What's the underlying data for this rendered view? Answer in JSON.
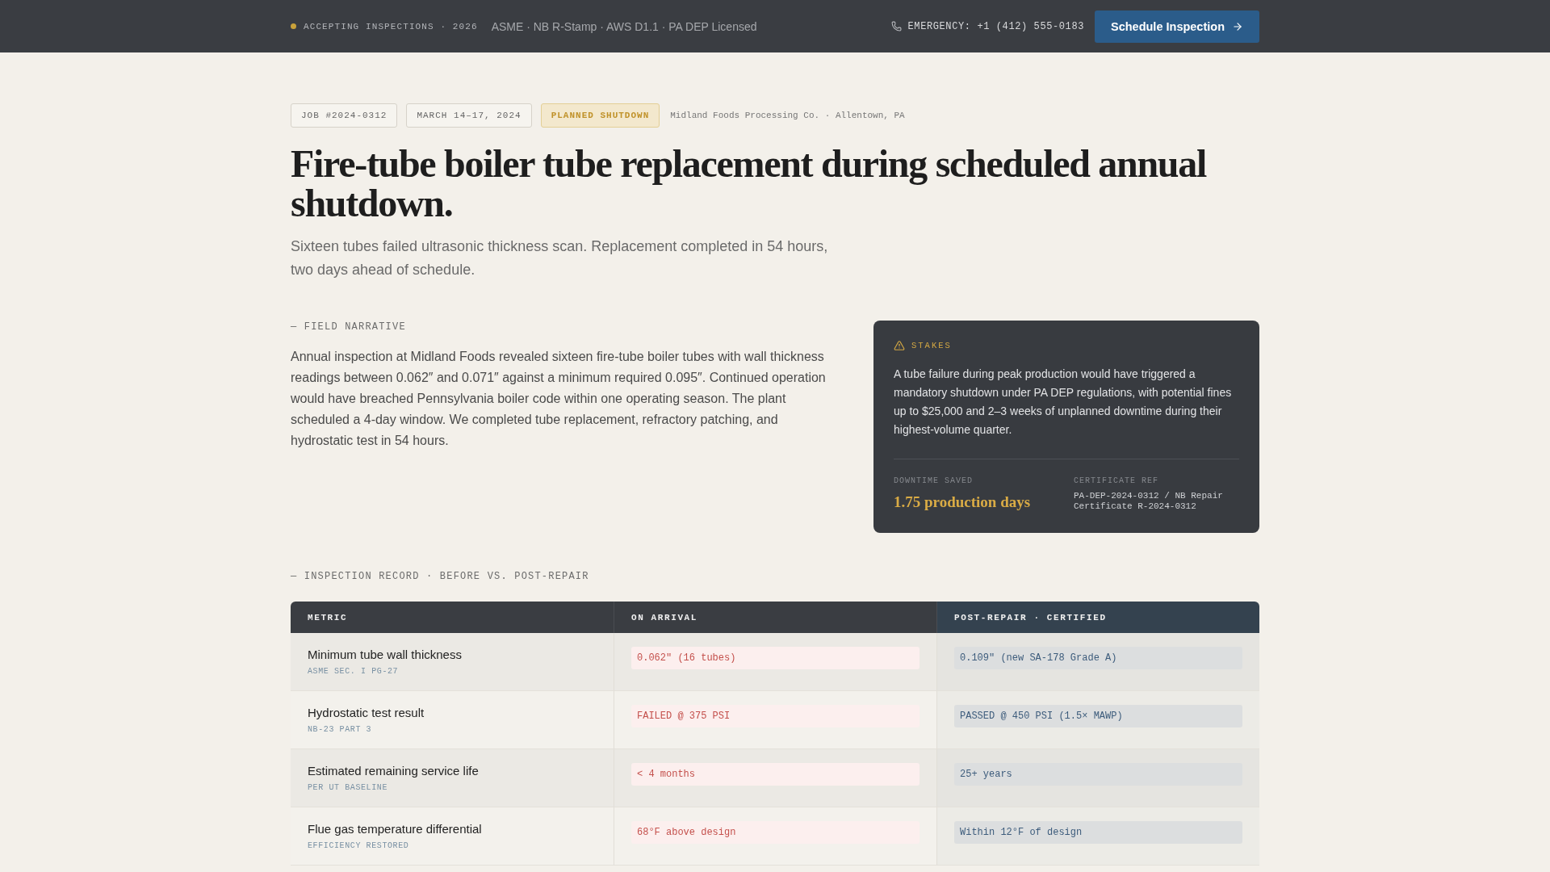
{
  "top_bar": {
    "status_label": "ACCEPTING INSPECTIONS · 2026",
    "credentials": "ASME · NB R-Stamp · AWS D1.1 · PA DEP Licensed",
    "emergency": "EMERGENCY: +1 (412) 555-0183",
    "cta_button": "Schedule Inspection"
  },
  "tags": [
    {
      "label": "JOB #2024-0312",
      "kind": "job"
    },
    {
      "label": "MARCH 14–17, 2024",
      "kind": "date"
    },
    {
      "label": "PLANNED SHUTDOWN",
      "kind": "status"
    }
  ],
  "client": "Midland Foods Processing Co. · Allentown, PA",
  "title": "Fire-tube boiler tube replacement during scheduled annual shutdown.",
  "subtitle": "Sixteen tubes failed ultrasonic thickness scan. Replacement completed in 54 hours, two days ahead of schedule.",
  "narrative": {
    "label": "— FIELD NARRATIVE",
    "body": "Annual inspection at Midland Foods revealed sixteen fire-tube boiler tubes with wall thickness readings between 0.062″ and 0.071″ against a minimum required 0.095″. Continued operation would have breached Pennsylvania boiler code within one operating season. The plant scheduled a 4-day window. We completed tube replacement, refractory patching, and hydrostatic test in 54 hours."
  },
  "stakes": {
    "label": "STAKES",
    "body": "A tube failure during peak production would have triggered a mandatory shutdown under PA DEP regulations, with potential fines up to $25,000 and 2–3 weeks of unplanned downtime during their highest-volume quarter.",
    "stats": [
      {
        "label": "DOWNTIME SAVED",
        "value": "1.75 production days",
        "kind": "highlight"
      },
      {
        "label": "CERTIFICATE REF",
        "value": "PA-DEP-2024-0312 / NB Repair Certificate R-2024-0312",
        "kind": "reference"
      }
    ]
  },
  "inspection": {
    "label": "— INSPECTION RECORD · BEFORE VS. POST-REPAIR",
    "table": {
      "columns": [
        {
          "label": "METRIC",
          "kind": "metric"
        },
        {
          "label": "ON ARRIVAL",
          "kind": "before"
        },
        {
          "label": "POST-REPAIR · CERTIFIED",
          "kind": "after"
        }
      ],
      "rows": [
        {
          "metric": "Minimum tube wall thickness",
          "reference": "ASME SEC. I PG-27",
          "on_arrival": "0.062\" (16 tubes)",
          "post_repair": "0.109\" (new SA-178 Grade A)"
        },
        {
          "metric": "Hydrostatic test result",
          "reference": "NB-23 PART 3",
          "on_arrival": "FAILED @ 375 PSI",
          "post_repair": "PASSED @ 450 PSI (1.5× MAWP)"
        },
        {
          "metric": "Estimated remaining service life",
          "reference": "PER UT BASELINE",
          "on_arrival": "< 4 months",
          "post_repair": "25+ years"
        },
        {
          "metric": "Flue gas temperature differential",
          "reference": "EFFICIENCY RESTORED",
          "on_arrival": "68°F above design",
          "post_repair": "Within 12°F of design"
        }
      ]
    }
  }
}
